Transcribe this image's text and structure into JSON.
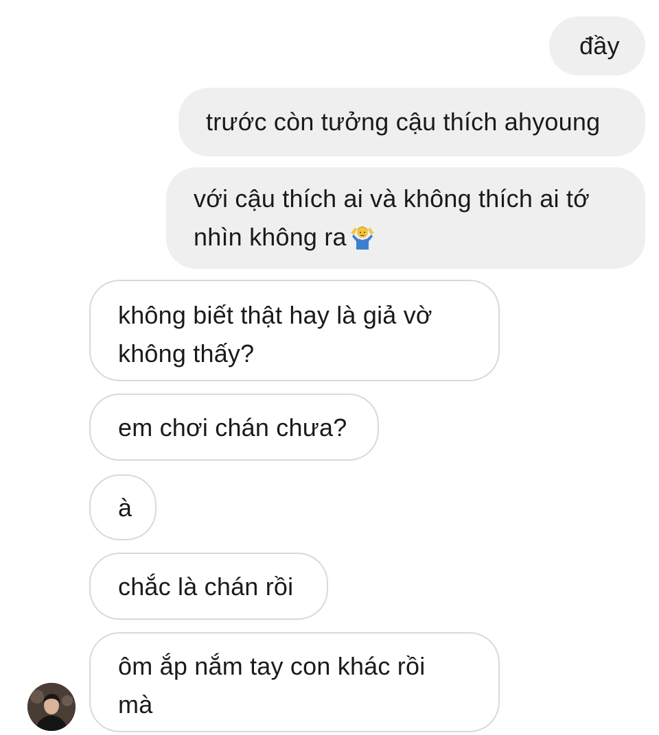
{
  "conversation": {
    "messages": [
      {
        "direction": "sent",
        "lines": [
          "đầy"
        ]
      },
      {
        "direction": "sent",
        "lines": [
          "trước còn tưởng cậu thích ahyoung"
        ]
      },
      {
        "direction": "sent",
        "lines": [
          "với cậu thích ai và không thích ai tớ",
          "nhìn không ra"
        ],
        "emoji": "person-shrugging-icon"
      },
      {
        "direction": "received",
        "lines": [
          "không biết thật hay là giả vờ",
          "không thấy?"
        ]
      },
      {
        "direction": "received",
        "lines": [
          "em chơi chán chưa?"
        ]
      },
      {
        "direction": "received",
        "lines": [
          "à"
        ]
      },
      {
        "direction": "received",
        "lines": [
          "chắc là chán rồi"
        ]
      },
      {
        "direction": "received",
        "lines": [
          "ôm ắp nắm tay con khác rồi",
          "mà"
        ]
      }
    ],
    "contact_avatar_icon": "avatar-icon"
  },
  "colors": {
    "sent_bubble": "#efefef",
    "received_border": "#d9d9d9",
    "text": "#1a1a1a"
  }
}
